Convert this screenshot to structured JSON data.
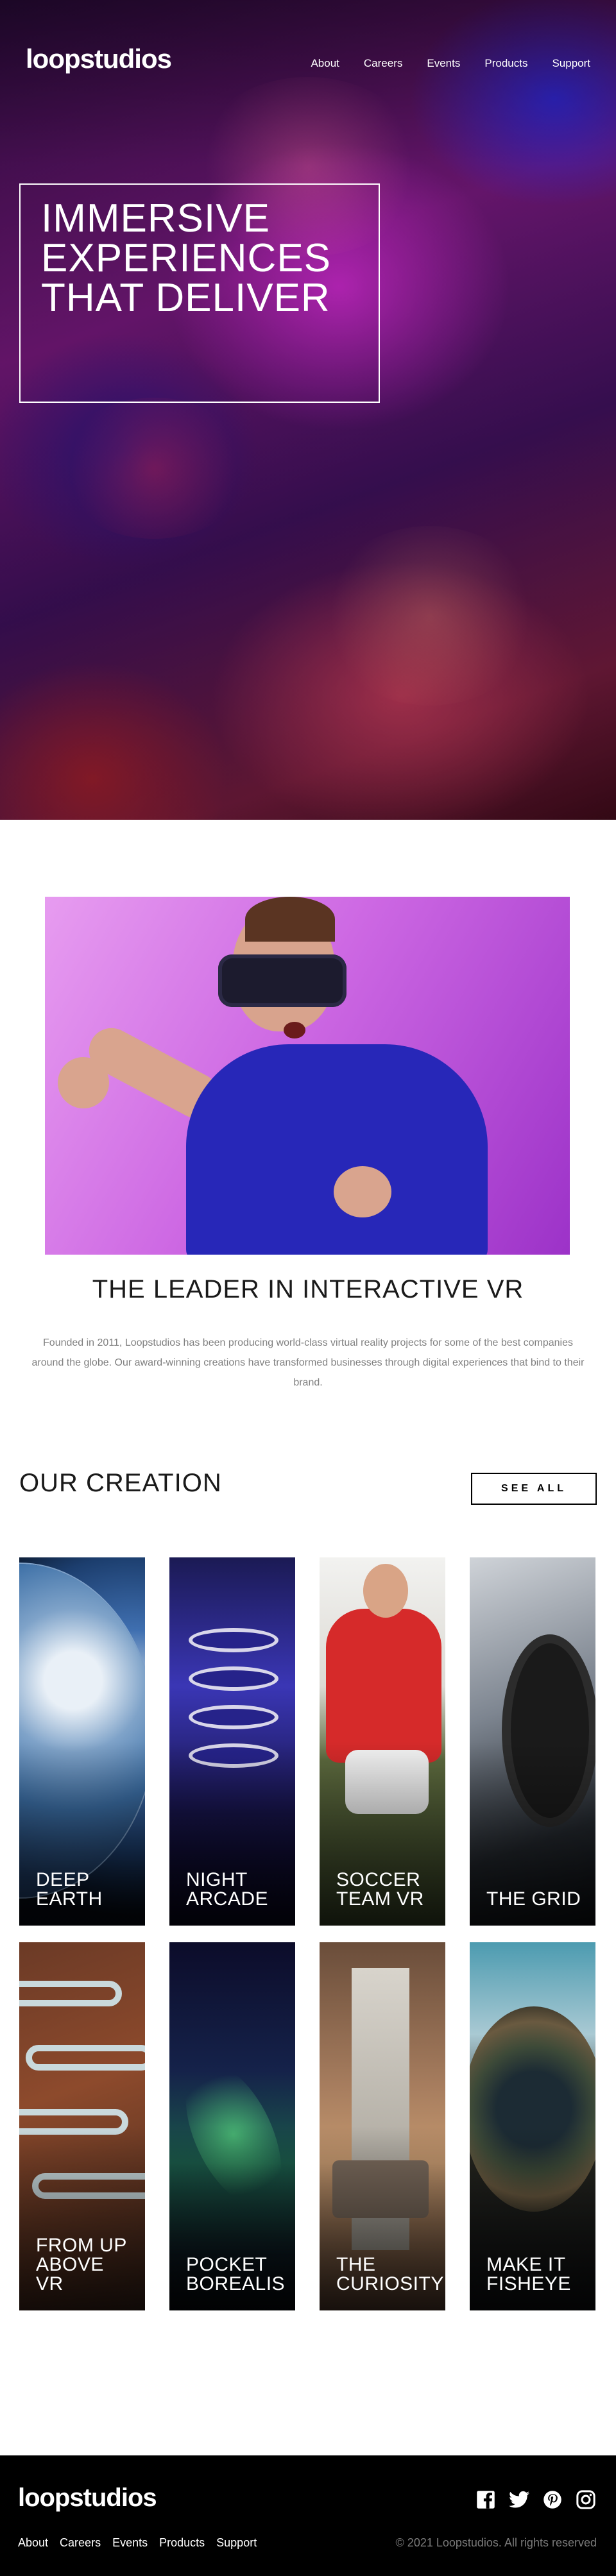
{
  "header": {
    "logo": "loopstudios",
    "nav": [
      "About",
      "Careers",
      "Events",
      "Products",
      "Support"
    ]
  },
  "hero": {
    "title": "IMMERSIVE\nEXPERIENCES\nTHAT DELIVER"
  },
  "intro": {
    "title": "THE LEADER IN INTERACTIVE VR",
    "text": "Founded in 2011, Loopstudios has been producing world-class virtual reality projects for some of the best companies around the globe. Our award-winning creations have transformed businesses through digital experiences that bind to their brand."
  },
  "creation": {
    "title": "OUR CREATION",
    "see_all": "SEE ALL",
    "items": [
      {
        "label": "DEEP\nEARTH"
      },
      {
        "label": "NIGHT\nARCADE"
      },
      {
        "label": "SOCCER\nTEAM VR"
      },
      {
        "label": "THE GRID"
      },
      {
        "label": "FROM UP\nABOVE\nVR"
      },
      {
        "label": "POCKET\nBOREALIS"
      },
      {
        "label": "THE\nCURIOSITY"
      },
      {
        "label": "MAKE IT\nFISHEYE"
      }
    ]
  },
  "footer": {
    "logo": "loopstudios",
    "nav": [
      "About",
      "Careers",
      "Events",
      "Products",
      "Support"
    ],
    "socials": [
      "facebook-icon",
      "twitter-icon",
      "pinterest-icon",
      "instagram-icon"
    ],
    "copyright": "© 2021 Loopstudios. All rights reserved"
  }
}
